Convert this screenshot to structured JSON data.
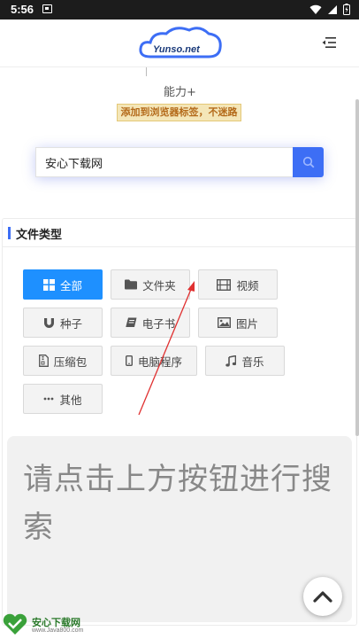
{
  "status_bar": {
    "time": "5:56"
  },
  "header": {
    "logo_text": "Yunso.net"
  },
  "promo": {
    "ability": "能力+",
    "badge": "添加到浏览器标签，不迷路"
  },
  "search": {
    "value": "安心下载网"
  },
  "file_types": {
    "title": "文件类型",
    "items": [
      {
        "label": "全部",
        "icon": "grid-icon",
        "active": true
      },
      {
        "label": "文件夹",
        "icon": "folder-icon",
        "active": false
      },
      {
        "label": "视频",
        "icon": "film-icon",
        "active": false
      },
      {
        "label": "种子",
        "icon": "magnet-icon",
        "active": false
      },
      {
        "label": "电子书",
        "icon": "book-icon",
        "active": false
      },
      {
        "label": "图片",
        "icon": "image-icon",
        "active": false
      },
      {
        "label": "压缩包",
        "icon": "archive-icon",
        "active": false
      },
      {
        "label": "电脑程序",
        "icon": "mobile-icon",
        "active": false
      },
      {
        "label": "音乐",
        "icon": "music-icon",
        "active": false
      },
      {
        "label": "其他",
        "icon": "more-icon",
        "active": false
      }
    ]
  },
  "result": {
    "message": "请点击上方按钮进行搜索"
  },
  "watermark": {
    "name": "安心下载网",
    "url": "www.Java800.com"
  },
  "colors": {
    "accent": "#3d6ef5",
    "active": "#1e90ff",
    "badge_bg": "#f4e6b8",
    "badge_text": "#b46a1a",
    "annotation": "#e03030"
  }
}
